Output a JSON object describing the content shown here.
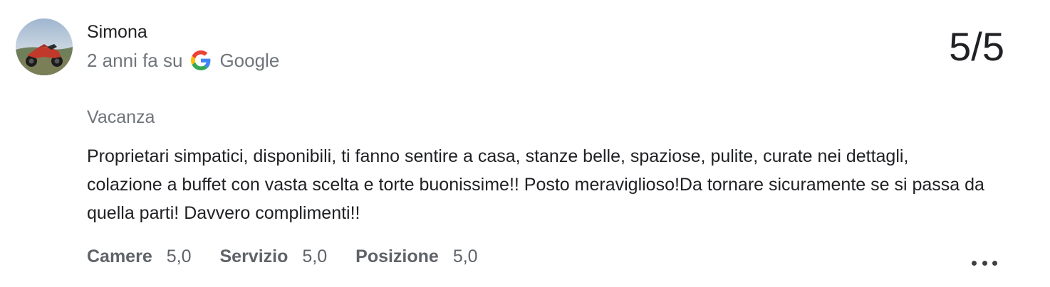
{
  "review": {
    "author_name": "Simona",
    "time_ago": "2 anni fa su",
    "source": "Google",
    "source_icon": "google-g-icon",
    "score": "5/5",
    "trip_type": "Vacanza",
    "text": "Proprietari simpatici, disponibili, ti fanno sentire a casa, stanze belle, spaziose, pulite, curate nei dettagli, colazione a buffet con vasta scelta e torte buonissime!! Posto meraviglioso!Da tornare sicuramente se si passa da quella parti! Davvero complimenti!!",
    "sub_ratings": [
      {
        "label": "Camere",
        "value": "5,0"
      },
      {
        "label": "Servizio",
        "value": "5,0"
      },
      {
        "label": "Posizione",
        "value": "5,0"
      }
    ],
    "more_icon": "more-horizontal-icon"
  },
  "colors": {
    "primary_text": "#202124",
    "secondary_text": "#70757a",
    "subrating_text": "#5f6368",
    "google_blue": "#4285F4",
    "google_red": "#EA4335",
    "google_yellow": "#FBBC05",
    "google_green": "#34A853"
  }
}
